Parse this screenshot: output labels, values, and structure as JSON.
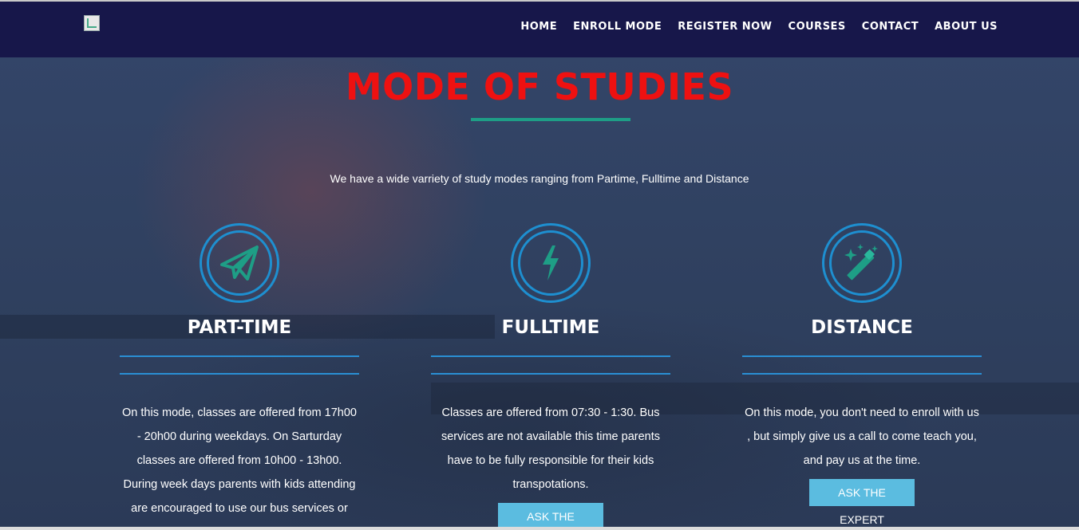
{
  "nav": {
    "items": [
      "HOME",
      "ENROLL MODE",
      "REGISTER NOW",
      "COURSES",
      "CONTACT",
      "ABOUT US"
    ]
  },
  "main": {
    "title": "MODE OF STUDIES",
    "subtitle": "We have a wide varriety of study modes ranging from Partime, Fulltime and Distance",
    "modes": [
      {
        "icon": "paper-plane-icon",
        "heading": "PART-TIME",
        "description": "On this mode, classes are offered from 17h00 - 20h00 during weekdays. On Sarturday classes are offered from 10h00 - 13h00. During week days parents with kids attending are encouraged to use our bus services or"
      },
      {
        "icon": "lightning-bolt-icon",
        "heading": "FULLTIME",
        "description": "Classes are offered from 07:30 - 1:30. Bus services are not available this time parents have to be fully responsible for their kids transpotations.",
        "button": "ASK THE EXPERT"
      },
      {
        "icon": "magic-wand-icon",
        "heading": "DISTANCE",
        "description": "On this mode, you don't need to enroll with us , but simply give us a call to come teach you, and pay us at the time.",
        "button": "ASK THE EXPERT"
      }
    ]
  },
  "colors": {
    "header_bg": "#17174a",
    "title": "#ee1111",
    "accent_rule": "#1e9e86",
    "ring": "#1e8fd0",
    "icon": "#1e9e86",
    "button": "#5bbce0"
  }
}
